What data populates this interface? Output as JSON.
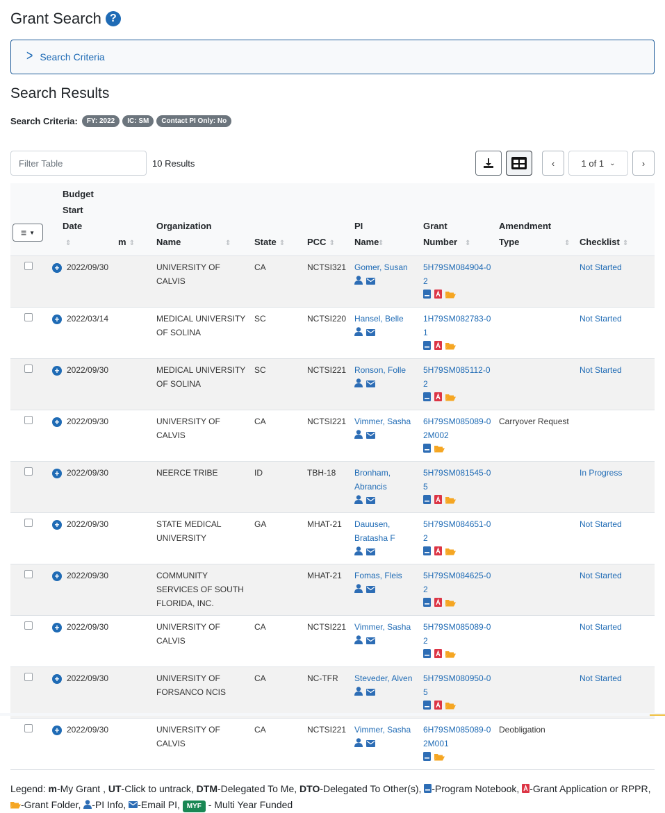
{
  "page": {
    "title": "Grant Search",
    "help_icon": "question-circle-icon"
  },
  "criteria_panel": {
    "label": "Search Criteria",
    "icon": "chevron-right-icon"
  },
  "results": {
    "heading": "Search Results",
    "criteria_label": "Search Criteria:",
    "badges": [
      "FY: 2022",
      "IC: SM",
      "Contact PI Only: No"
    ],
    "filter_placeholder": "Filter Table",
    "filter_value": "",
    "count_text": "10 Results",
    "pagination": {
      "prev": "‹",
      "current": "1 of 1",
      "next": "›"
    },
    "toolbar_icons": [
      "download-icon",
      "table-layout-icon"
    ]
  },
  "table": {
    "menu_icon": "hamburger-menu-icon",
    "columns": [
      {
        "key": "budget_start",
        "label": "Budget Start Date"
      },
      {
        "key": "m",
        "label": "m"
      },
      {
        "key": "org",
        "label": "Organization Name"
      },
      {
        "key": "state",
        "label": "State"
      },
      {
        "key": "pcc",
        "label": "PCC"
      },
      {
        "key": "pi",
        "label": "PI Name"
      },
      {
        "key": "grant",
        "label": "Grant Number"
      },
      {
        "key": "amend",
        "label": "Amendment Type"
      },
      {
        "key": "checklist",
        "label": "Checklist"
      }
    ],
    "rows": [
      {
        "budget_start": "2022/09/30",
        "m": "",
        "org": "UNIVERSITY OF CALVIS",
        "state": "CA",
        "pcc": "NCTSI321",
        "pi": "Gomer, Susan",
        "grant": "5H79SM084904-02",
        "pdf": true,
        "amend": "",
        "checklist": "Not Started"
      },
      {
        "budget_start": "2022/03/14",
        "m": "",
        "org": "MEDICAL UNIVERSITY OF SOLINA",
        "state": "SC",
        "pcc": "NCTSI220",
        "pi": "Hansel, Belle",
        "grant": "1H79SM082783-01",
        "pdf": true,
        "amend": "",
        "checklist": "Not Started"
      },
      {
        "budget_start": "2022/09/30",
        "m": "",
        "org": "MEDICAL UNIVERSITY OF SOLINA",
        "state": "SC",
        "pcc": "NCTSI221",
        "pi": "Ronson, Folle",
        "grant": "5H79SM085112-02",
        "pdf": true,
        "amend": "",
        "checklist": "Not Started"
      },
      {
        "budget_start": "2022/09/30",
        "m": "",
        "org": "UNIVERSITY OF CALVIS",
        "state": "CA",
        "pcc": "NCTSI221",
        "pi": "Vimmer, Sasha",
        "grant": "6H79SM085089-02M002",
        "pdf": false,
        "amend": "Carryover Request",
        "checklist": ""
      },
      {
        "budget_start": "2022/09/30",
        "m": "",
        "org": "NEERCE TRIBE",
        "state": "ID",
        "pcc": "TBH-18",
        "pi": "Bronham, Abrancis",
        "grant": "5H79SM081545-05",
        "pdf": true,
        "amend": "",
        "checklist": "In Progress"
      },
      {
        "budget_start": "2022/09/30",
        "m": "",
        "org": "STATE MEDICAL UNIVERSITY",
        "state": "GA",
        "pcc": "MHAT-21",
        "pi": "Dauusen, Bratasha F",
        "grant": "5H79SM084651-02",
        "pdf": true,
        "amend": "",
        "checklist": "Not Started"
      },
      {
        "budget_start": "2022/09/30",
        "m": "",
        "org": "COMMUNITY SERVICES OF SOUTH FLORIDA, INC.",
        "state": "",
        "pcc": "MHAT-21",
        "pi": "Fomas, Fleis",
        "grant": "5H79SM084625-02",
        "pdf": true,
        "amend": "",
        "checklist": "Not Started"
      },
      {
        "budget_start": "2022/09/30",
        "m": "",
        "org": "UNIVERSITY OF CALVIS",
        "state": "CA",
        "pcc": "NCTSI221",
        "pi": "Vimmer, Sasha",
        "grant": "5H79SM085089-02",
        "pdf": true,
        "amend": "",
        "checklist": "Not Started"
      },
      {
        "budget_start": "2022/09/30",
        "m": "",
        "org": "UNIVERSITY OF FORSANCO NCIS",
        "state": "CA",
        "pcc": "NC-TFR",
        "pi": "Steveder, Alven",
        "grant": "5H79SM080950-05",
        "pdf": true,
        "amend": "",
        "checklist": "Not Started"
      },
      {
        "budget_start": "2022/09/30",
        "m": "",
        "org": "UNIVERSITY OF CALVIS",
        "state": "CA",
        "pcc": "NCTSI221",
        "pi": "Vimmer, Sasha",
        "grant": "6H79SM085089-02M001",
        "pdf": false,
        "amend": "Deobligation",
        "checklist": ""
      }
    ]
  },
  "legend": {
    "prefix": "Legend:",
    "m_key": "m",
    "m_text": "-My Grant ,",
    "ut_key": "UT",
    "ut_text": "-Click to untrack,",
    "dtm_key": "DTM",
    "dtm_text": "-Delegated To Me,",
    "dto_key": "DTO",
    "dto_text": "-Delegated To Other(s),",
    "notebook_text": "-Program Notebook,",
    "pdf_text": "-Grant Application or RPPR,",
    "folder_text": "-Grant Folder,",
    "pi_text": "-PI Info,",
    "email_text": "-Email PI,",
    "myf_badge": "MYF",
    "myf_text": "- Multi Year Funded"
  },
  "colors": {
    "link": "#1f6bb5",
    "notebook": "#2d6db5",
    "pdf": "#dc3545",
    "folder": "#f5a623",
    "badge_gray": "#6c757d",
    "myf_green": "#198754"
  }
}
